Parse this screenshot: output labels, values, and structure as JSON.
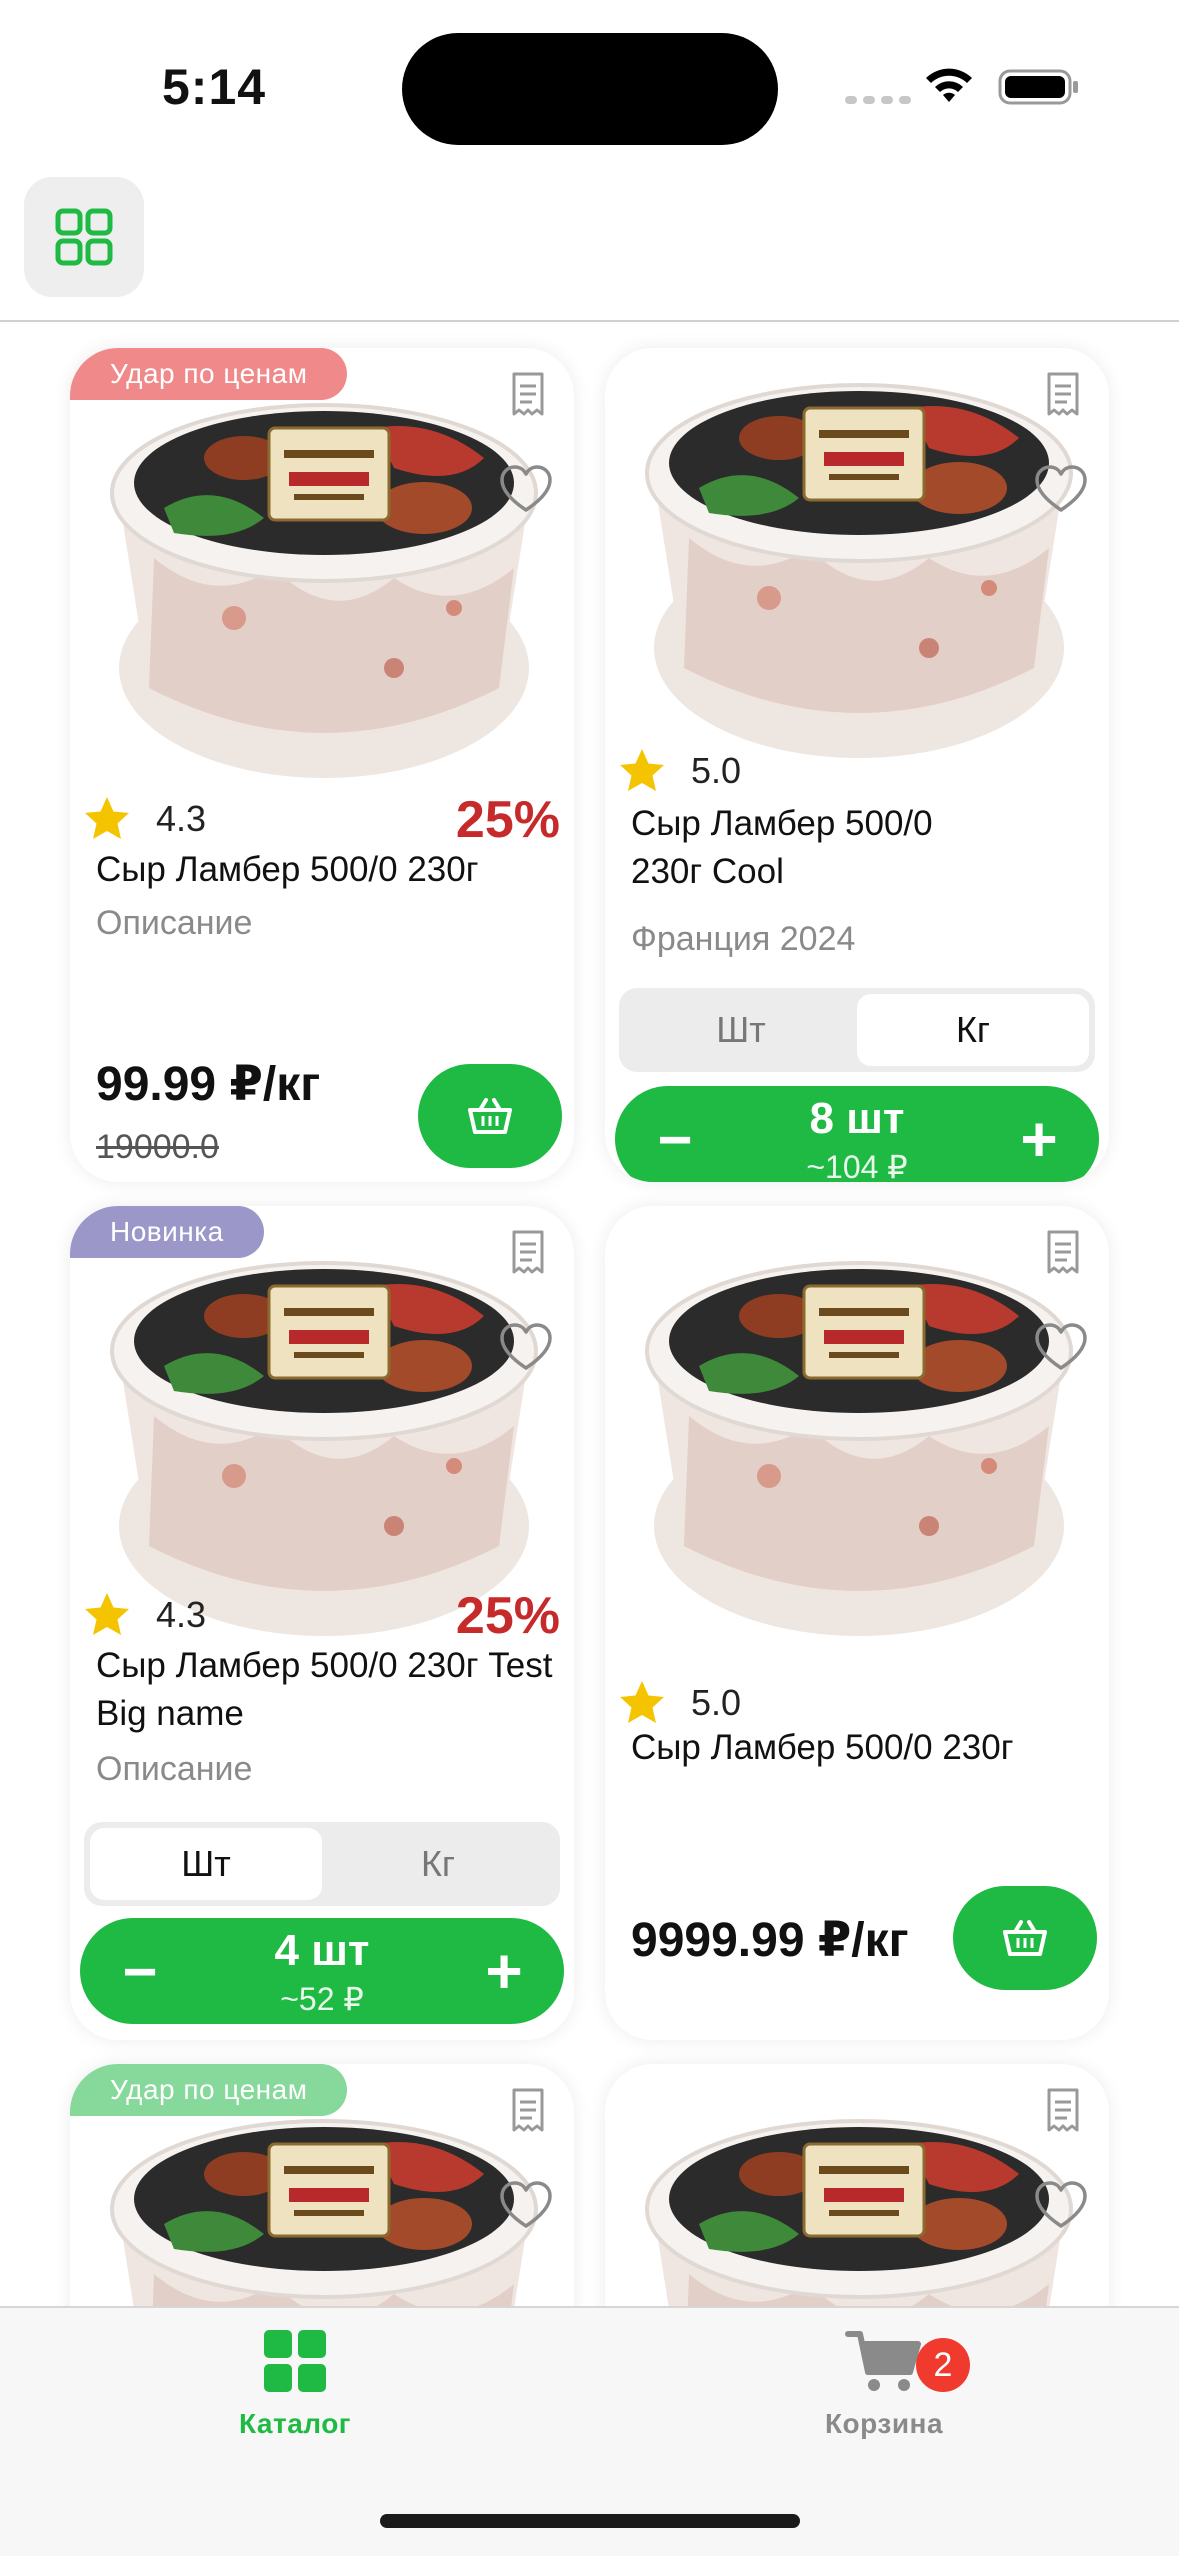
{
  "status_bar": {
    "time": "5:14"
  },
  "header": {
    "grid_toggle_icon": "grid-icon"
  },
  "products": [
    {
      "badge": "Удар по ценам",
      "rating": "4.3",
      "discount": "25%",
      "name": "Сыр Ламбер 500/0 230г",
      "description": "Описание",
      "price": "99.99 ₽/кг",
      "old_price": "19000.0"
    },
    {
      "rating": "5.0",
      "name": "Сыр Ламбер 500/0 230г Cool",
      "description": "Франция 2024",
      "unit_options": [
        "Шт",
        "Кг"
      ],
      "selected_unit": "Кг",
      "quantity": "8 шт",
      "sum": "~104 ₽"
    },
    {
      "badge": "Новинка",
      "rating": "4.3",
      "discount": "25%",
      "name": "Сыр Ламбер 500/0 230г Test Big name",
      "description": "Описание",
      "unit_options": [
        "Шт",
        "Кг"
      ],
      "selected_unit": "Шт",
      "quantity": "4 шт",
      "sum": "~52 ₽"
    },
    {
      "rating": "5.0",
      "name": "Сыр Ламбер 500/0 230г",
      "price": "9999.99 ₽/кг"
    },
    {
      "badge": "Удар по ценам"
    },
    {}
  ],
  "tab_bar": {
    "tabs": [
      {
        "label": "Каталог",
        "icon": "catalog-grid-icon",
        "active": true
      },
      {
        "label": "Корзина",
        "icon": "cart-icon",
        "badge": "2"
      }
    ]
  },
  "colors": {
    "accent": "#1fba44",
    "discount": "#c62a2a",
    "badge_sale": "#f08a8a",
    "badge_new": "#9c97c9",
    "cart_badge": "#f03a2e"
  }
}
